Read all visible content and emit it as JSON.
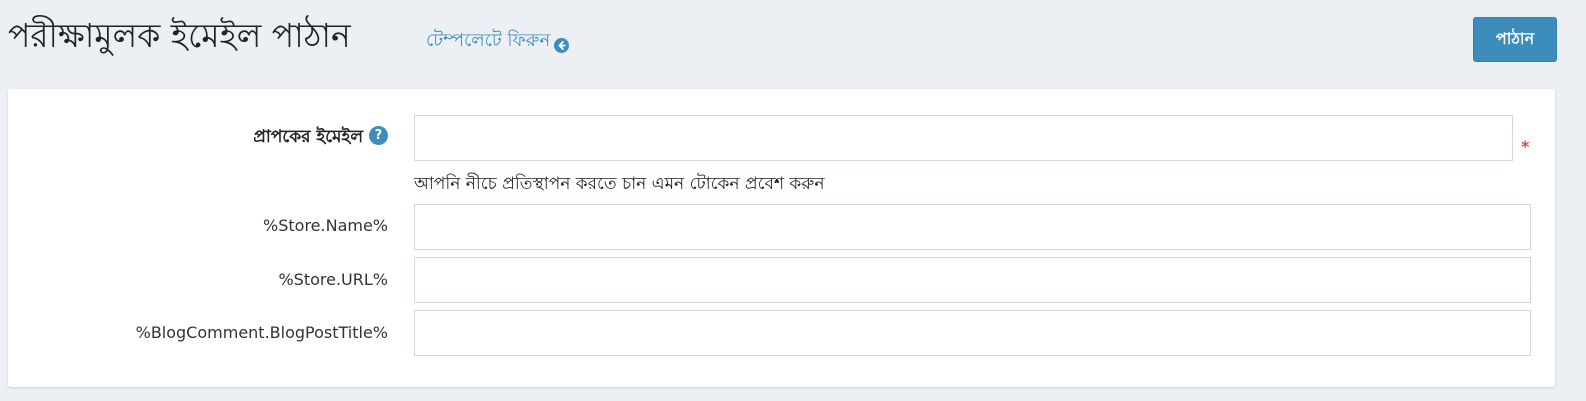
{
  "header": {
    "title": "পরীক্ষামুলক ইমেইল পাঠান",
    "back_link": "টেম্পলেটে ফিরুন",
    "send_button": "পাঠান"
  },
  "form": {
    "recipient_label": "প্রাপকের ইমেইল",
    "recipient_value": "",
    "required_mark": "*",
    "hint": "আপনি নীচে প্রতিস্থাপন করতে চান এমন টোকেন প্রবেশ করুন",
    "tokens": [
      {
        "label": "%Store.Name%",
        "value": ""
      },
      {
        "label": "%Store.URL%",
        "value": ""
      },
      {
        "label": "%BlogComment.BlogPostTitle%",
        "value": ""
      }
    ]
  },
  "colors": {
    "accent": "#3c8dbc",
    "background": "#ecf0f5",
    "required": "#dd4b39"
  }
}
